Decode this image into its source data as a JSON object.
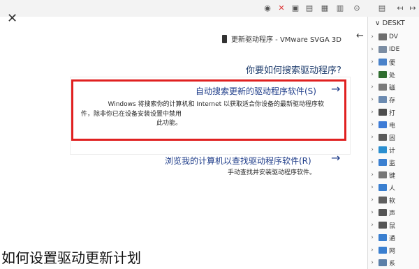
{
  "dialog": {
    "breadcrumb": "更新驱动程序 - VMware SVGA 3D",
    "question": "你要如何搜索驱动程序?",
    "option1": {
      "title": "自动搜索更新的驱动程序软件(S)",
      "desc_line1": "Windows 将搜索你的计算机和 Internet 以获取适合你设备的最新驱动程序软",
      "desc_line2": "件，除非你已在设备安装设置中禁用此功能。"
    },
    "option2": {
      "title": "浏览我的计算机以查找驱动程序软件(R)",
      "desc": "手动查找并安装驱动程序软件。"
    }
  },
  "devices": {
    "root": "DESKT",
    "items": [
      {
        "label": "DV",
        "color": "#6d6d6d"
      },
      {
        "label": "IDE",
        "color": "#7b8da3"
      },
      {
        "label": "便",
        "color": "#4a82c9"
      },
      {
        "label": "处",
        "color": "#2f6d2f"
      },
      {
        "label": "磁",
        "color": "#7a7a7a"
      },
      {
        "label": "存",
        "color": "#6c8bb1"
      },
      {
        "label": "打",
        "color": "#4d4d4d"
      },
      {
        "label": "电",
        "color": "#3d7bd6"
      },
      {
        "label": "固",
        "color": "#5a5a5a"
      },
      {
        "label": "计",
        "color": "#2b8fd0"
      },
      {
        "label": "监",
        "color": "#3a7fd0"
      },
      {
        "label": "键",
        "color": "#777777"
      },
      {
        "label": "人",
        "color": "#3a7fd0"
      },
      {
        "label": "软",
        "color": "#5f5f5f"
      },
      {
        "label": "声",
        "color": "#555555"
      },
      {
        "label": "鼠",
        "color": "#555555"
      },
      {
        "label": "通",
        "color": "#3a7fd0"
      },
      {
        "label": "网",
        "color": "#3a7fd0"
      },
      {
        "label": "系",
        "color": "#5b7fa8"
      }
    ]
  },
  "caption": "如何设置驱动更新计划"
}
